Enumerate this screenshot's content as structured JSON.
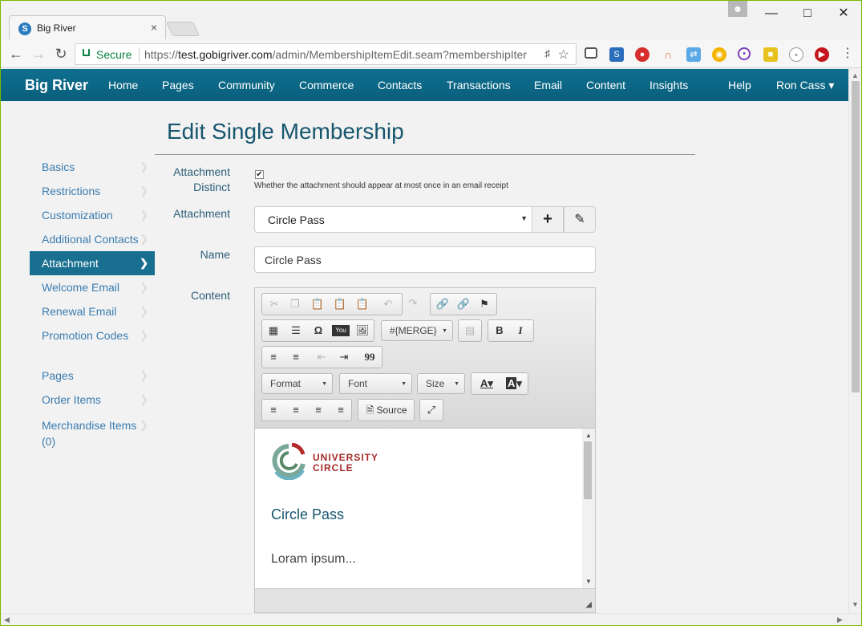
{
  "browser": {
    "tab_title": "Big River",
    "tab_close": "×",
    "secure_label": "Secure",
    "url_scheme": "https://",
    "url_host": "test.gobigriver.com",
    "url_path": "/admin/MembershipItemEdit.seam?membershipIter"
  },
  "nav": {
    "brand": "Big River",
    "items": [
      "Home",
      "Pages",
      "Community",
      "Commerce",
      "Contacts",
      "Transactions",
      "Email",
      "Content",
      "Insights"
    ],
    "help": "Help",
    "user": "Ron Cass ▾"
  },
  "page": {
    "title": "Edit Single Membership"
  },
  "sidebar": {
    "group1": [
      "Basics",
      "Restrictions",
      "Customization",
      "Additional Contacts",
      "Attachment",
      "Welcome Email",
      "Renewal Email",
      "Promotion Codes"
    ],
    "group2": [
      "Pages",
      "Order Items",
      "Merchandise Items",
      "(0)"
    ],
    "active": "Attachment"
  },
  "form": {
    "attachment_distinct_label_1": "Attachment",
    "attachment_distinct_label_2": "Distinct",
    "attachment_distinct_checked": true,
    "attachment_distinct_help": "Whether the attachment should appear at most once in an email receipt",
    "attachment_label": "Attachment",
    "attachment_value": "Circle Pass",
    "name_label": "Name",
    "name_value": "Circle Pass",
    "content_label": "Content"
  },
  "editor": {
    "merge_label": "#{MERGE}",
    "format_label": "Format",
    "font_label": "Font",
    "size_label": "Size",
    "source_label": "Source",
    "bold": "B",
    "italic": "I",
    "quote": "99",
    "logo_line1": "UNIVERSITY",
    "logo_line2": "CIRCLE",
    "content_title": "Circle Pass",
    "content_body": "Loram ipsum..."
  },
  "colors": {
    "nav_bg": "#0e6f8f",
    "active_sidebar": "#186f8f",
    "link": "#3a7cb0",
    "heading": "#17566f",
    "logo_red": "#a52b2b"
  }
}
